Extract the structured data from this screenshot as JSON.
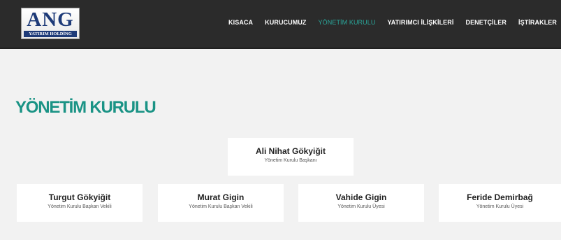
{
  "header": {
    "logo": {
      "text": "ANG",
      "subtext": "YATIRIM HOLDİNG"
    },
    "nav": [
      {
        "label": "KISACA",
        "active": false
      },
      {
        "label": "KURUCUMUZ",
        "active": false
      },
      {
        "label": "YÖNETİM KURULU",
        "active": true
      },
      {
        "label": "YATIRIMCI İLİŞKİLERİ",
        "active": false
      },
      {
        "label": "DENETÇİLER",
        "active": false
      },
      {
        "label": "İŞTİRAKLER",
        "active": false
      }
    ]
  },
  "main": {
    "title": "YÖNETİM KURULU",
    "chair": {
      "name": "Ali Nihat Gökyiğit",
      "role": "Yönetim Kurulu Başkanı"
    },
    "members": [
      {
        "name": "Turgut Gökyiğit",
        "role": "Yönetim Kurulu Başkan Vekili"
      },
      {
        "name": "Murat Gigin",
        "role": "Yönetim Kurulu Başkan Vekili"
      },
      {
        "name": "Vahide Gigin",
        "role": "Yönetim Kurulu Üyesi"
      },
      {
        "name": "Feride Demirbağ",
        "role": "Yönetim Kurulu Üyesi"
      }
    ]
  },
  "colors": {
    "accent": "#1a9385",
    "nav_active": "#2aa89c",
    "header_bg": "#2b2b2b",
    "logo_blue": "#1d3a78",
    "page_bg": "#f2f2f2"
  }
}
